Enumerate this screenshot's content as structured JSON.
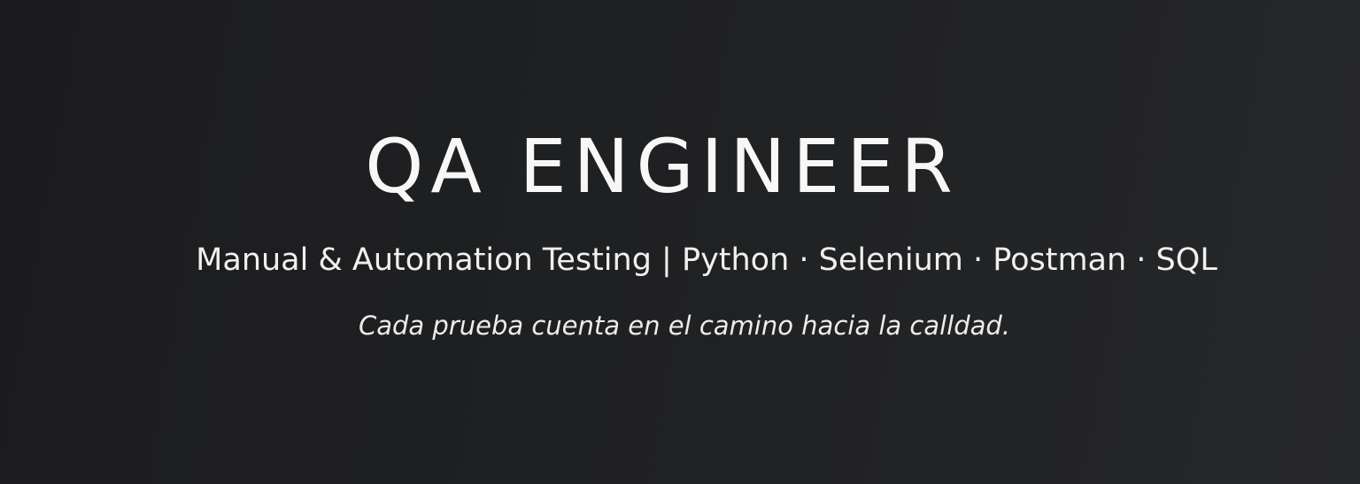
{
  "banner": {
    "title": "QA ENGINEER",
    "subtitle": "Manual & Automation Testing | Python · Selenium · Postman · SQL",
    "tagline": "Cada prueba cuenta en el camino hacia la calldad."
  },
  "colors": {
    "background": "#1f2022",
    "text": "#f4f4f4"
  }
}
